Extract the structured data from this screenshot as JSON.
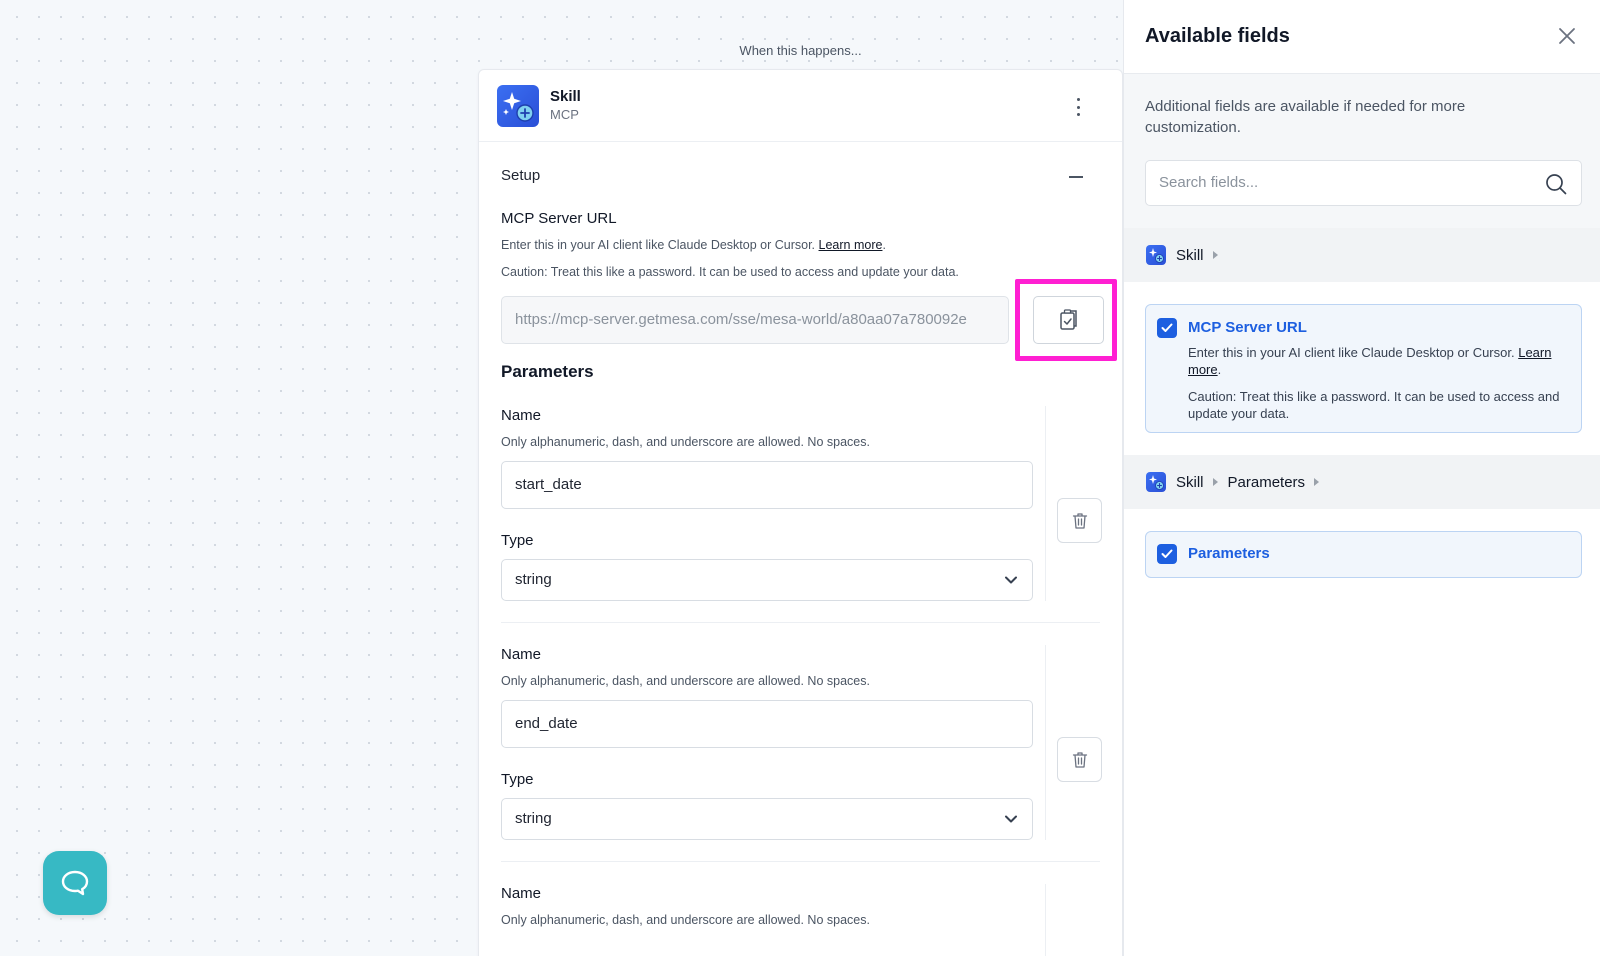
{
  "canvas": {
    "when_label": "When this happens..."
  },
  "step": {
    "title": "Skill",
    "subtitle": "MCP",
    "setup_label": "Setup",
    "mcp": {
      "label": "MCP Server URL",
      "helper_prefix": "Enter this in your AI client like Claude Desktop or Cursor.",
      "learn_more": "Learn more",
      "helper_suffix": ".",
      "caution": "Caution: Treat this like a password. It can be used to access and update your data.",
      "url_value": "https://mcp-server.getmesa.com/sse/mesa-world/a80aa07a780092e"
    },
    "parameters_heading": "Parameters",
    "parameters": [
      {
        "name_label": "Name",
        "name_helper": "Only alphanumeric, dash, and underscore are allowed. No spaces.",
        "name_value": "start_date",
        "type_label": "Type",
        "type_value": "string"
      },
      {
        "name_label": "Name",
        "name_helper": "Only alphanumeric, dash, and underscore are allowed. No spaces.",
        "name_value": "end_date",
        "type_label": "Type",
        "type_value": "string"
      },
      {
        "name_label": "Name",
        "name_helper": "Only alphanumeric, dash, and underscore are allowed. No spaces."
      }
    ]
  },
  "panel": {
    "title": "Available fields",
    "intro": "Additional fields are available if needed for more customization.",
    "search_placeholder": "Search fields...",
    "group1": {
      "crumb": "Skill",
      "field_title": "MCP Server URL",
      "desc_prefix": "Enter this in your AI client like Claude Desktop or Cursor. ",
      "learn_more": "Learn more",
      "desc_suffix": ".",
      "caution": "Caution: Treat this like a password. It can be used to access and update your data."
    },
    "group2": {
      "crumb1": "Skill",
      "crumb2": "Parameters",
      "field_title": "Parameters"
    }
  },
  "colors": {
    "accent": "#1d5fe0",
    "highlight": "#ff1fd2",
    "chat": "#37b9c4"
  },
  "icons": [
    "sparkle-plus-icon",
    "kebab-menu-icon",
    "minus-icon",
    "clipboard-check-icon",
    "trash-icon",
    "chevron-down-icon",
    "chat-icon",
    "close-icon",
    "search-icon",
    "check-icon"
  ]
}
